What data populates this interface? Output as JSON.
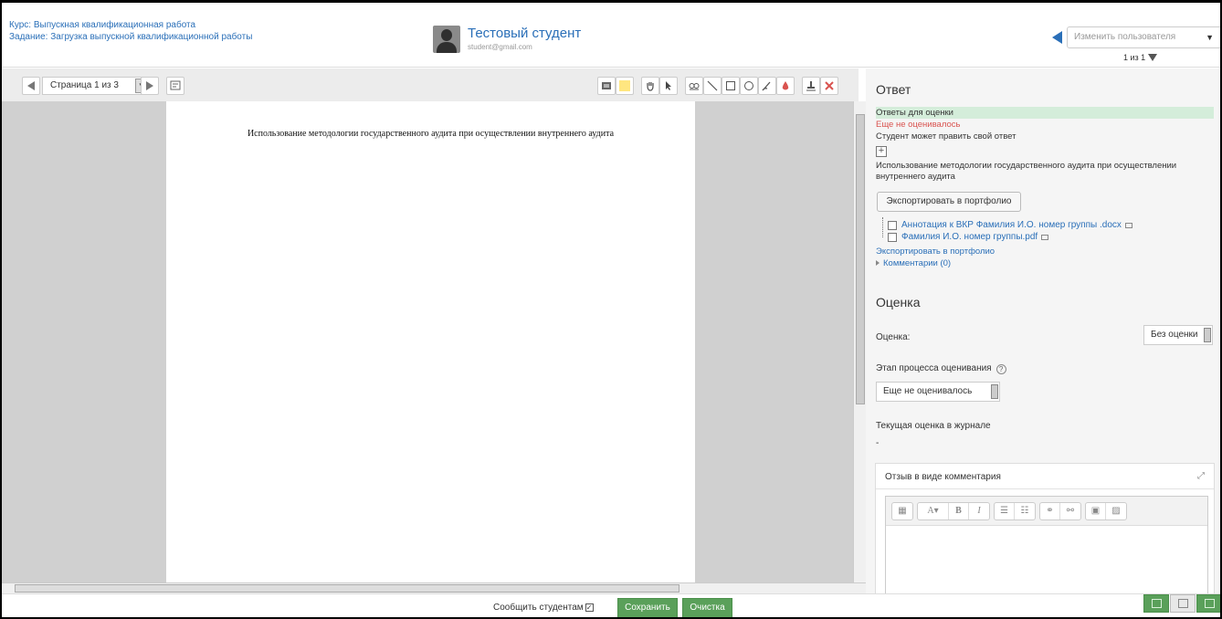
{
  "header": {
    "course_line": "Курс: Выпускная квалификационная работа",
    "assignment_line": "Задание: Загрузка выпускной квалификационной работы",
    "student_name": "Тестовый студент",
    "student_email": "student@gmail.com",
    "change_user_placeholder": "Изменить пользователя",
    "user_count": "1 из 1"
  },
  "toolbar": {
    "page_select_value": "Страница 1 из 3"
  },
  "document": {
    "heading": "Использование методологии государственного аудита при осуществлении внутреннего аудита"
  },
  "panel": {
    "answer_title": "Ответ",
    "submissions_label": "Ответы для оценки",
    "not_graded": "Еще не оценивалось",
    "can_edit": "Студент может править свой ответ",
    "submission_text": "Использование методологии государственного аудита при осуществлении внутреннего аудита",
    "export_button": "Экспортировать в портфолио",
    "files": [
      "Аннотация к ВКР Фамилия И.О. номер группы .docx",
      "Фамилия И.О. номер группы.pdf"
    ],
    "export_link": "Экспортировать в портфолио",
    "comments": "Комментарии (0)",
    "grade_title": "Оценка",
    "grade_label": "Оценка:",
    "grade_value": "Без оценки",
    "stage_label": "Этап процесса оценивания",
    "stage_value": "Еще не оценивалось",
    "current_grade_label": "Текущая оценка в журнале",
    "current_grade_value": "-",
    "feedback_title": "Отзыв в виде комментария"
  },
  "footer": {
    "notify_label": "Сообщить студентам",
    "save_button": "Сохранить",
    "reset_button": "Очистка"
  },
  "colors": {
    "link": "#2a6fb8",
    "accent_green": "#5aa05a",
    "error_red": "#d9534f",
    "highlight_green": "#d4edda"
  }
}
